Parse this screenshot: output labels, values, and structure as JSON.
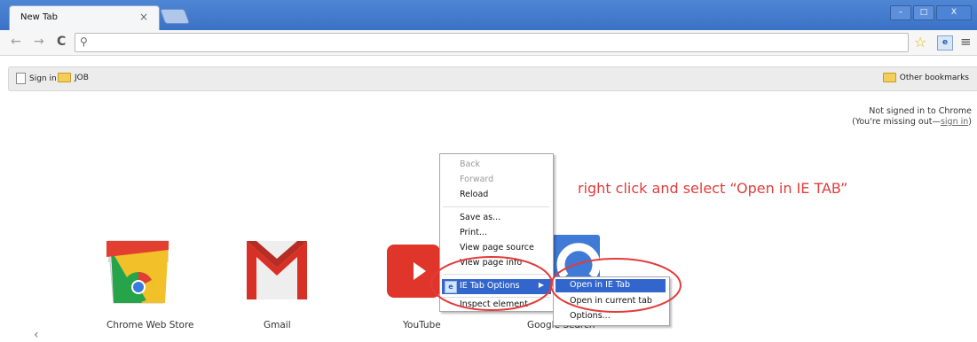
{
  "tab": {
    "title": "New Tab",
    "close": "×"
  },
  "window": {
    "minimize": "–",
    "maximize": "□",
    "close": "X"
  },
  "toolbar": {
    "back": "←",
    "forward": "→",
    "reload": "C",
    "search_icon": "⚲",
    "url_value": "",
    "star": "☆",
    "ie_tab": "e",
    "menu": "≡"
  },
  "bookmarks": {
    "items": [
      {
        "label": "Sign in",
        "icon": "page-icon"
      },
      {
        "label": "JOB",
        "icon": "folder-icon"
      }
    ],
    "other": "Other bookmarks"
  },
  "signin_note": {
    "line1": "Not signed in to Chrome",
    "line2_prefix": "(You're missing out—",
    "link": "sign in",
    "line2_suffix": ")"
  },
  "tiles": [
    {
      "label": "Chrome Web Store"
    },
    {
      "label": "Gmail"
    },
    {
      "label": "YouTube"
    },
    {
      "label": "Google Search"
    }
  ],
  "pager_prev": "‹",
  "context_menu": {
    "items": [
      {
        "label": "Back",
        "disabled": true
      },
      {
        "label": "Forward",
        "disabled": true
      },
      {
        "label": "Reload",
        "disabled": false
      },
      {
        "label": "Save as...",
        "disabled": false
      },
      {
        "label": "Print...",
        "disabled": false
      },
      {
        "label": "View page source",
        "disabled": false
      },
      {
        "label": "View page info",
        "disabled": false
      },
      {
        "label": "IE Tab Options",
        "disabled": false
      },
      {
        "label": "Inspect element",
        "disabled": false
      }
    ]
  },
  "submenu": {
    "items": [
      "Open in IE Tab",
      "Open in current tab",
      "Options..."
    ]
  },
  "annotation": "right click and select “Open in IE TAB”",
  "colors": {
    "highlight": "#3366cc",
    "annotation": "#e23b3b",
    "titlebar": "#4a80d0"
  }
}
